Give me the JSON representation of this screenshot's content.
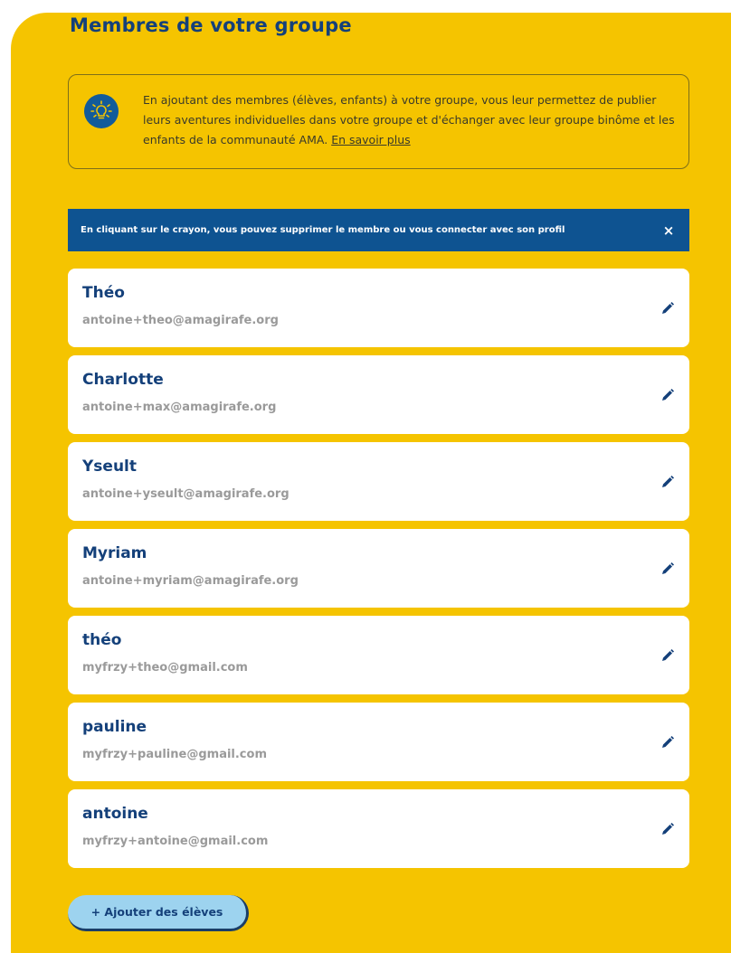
{
  "section": {
    "title": "Membres de votre groupe"
  },
  "info": {
    "text": "En ajoutant des membres (élèves, enfants) à votre groupe, vous leur permettez de publier leurs aventures individuelles dans votre groupe et d'échanger avec leur groupe binôme et les enfants de la communauté AMA.",
    "link_label": "En savoir plus",
    "icon": "lightbulb-icon"
  },
  "banner": {
    "text": "En cliquant sur le crayon, vous pouvez supprimer le membre ou vous connecter avec son profil",
    "close_label": "×"
  },
  "members": [
    {
      "name": "Théo",
      "email": "antoine+theo@amagirafe.org"
    },
    {
      "name": "Charlotte",
      "email": "antoine+max@amagirafe.org"
    },
    {
      "name": "Yseult",
      "email": "antoine+yseult@amagirafe.org"
    },
    {
      "name": "Myriam",
      "email": "antoine+myriam@amagirafe.org"
    },
    {
      "name": "théo",
      "email": "myfrzy+theo@gmail.com"
    },
    {
      "name": "pauline",
      "email": "myfrzy+pauline@gmail.com"
    },
    {
      "name": "antoine",
      "email": "myfrzy+antoine@gmail.com"
    }
  ],
  "actions": {
    "add_label": "+ Ajouter des élèves"
  },
  "colors": {
    "panel": "#f5c400",
    "title": "#14407a",
    "banner": "#0e5391",
    "add_button": "#9dd3ef"
  }
}
